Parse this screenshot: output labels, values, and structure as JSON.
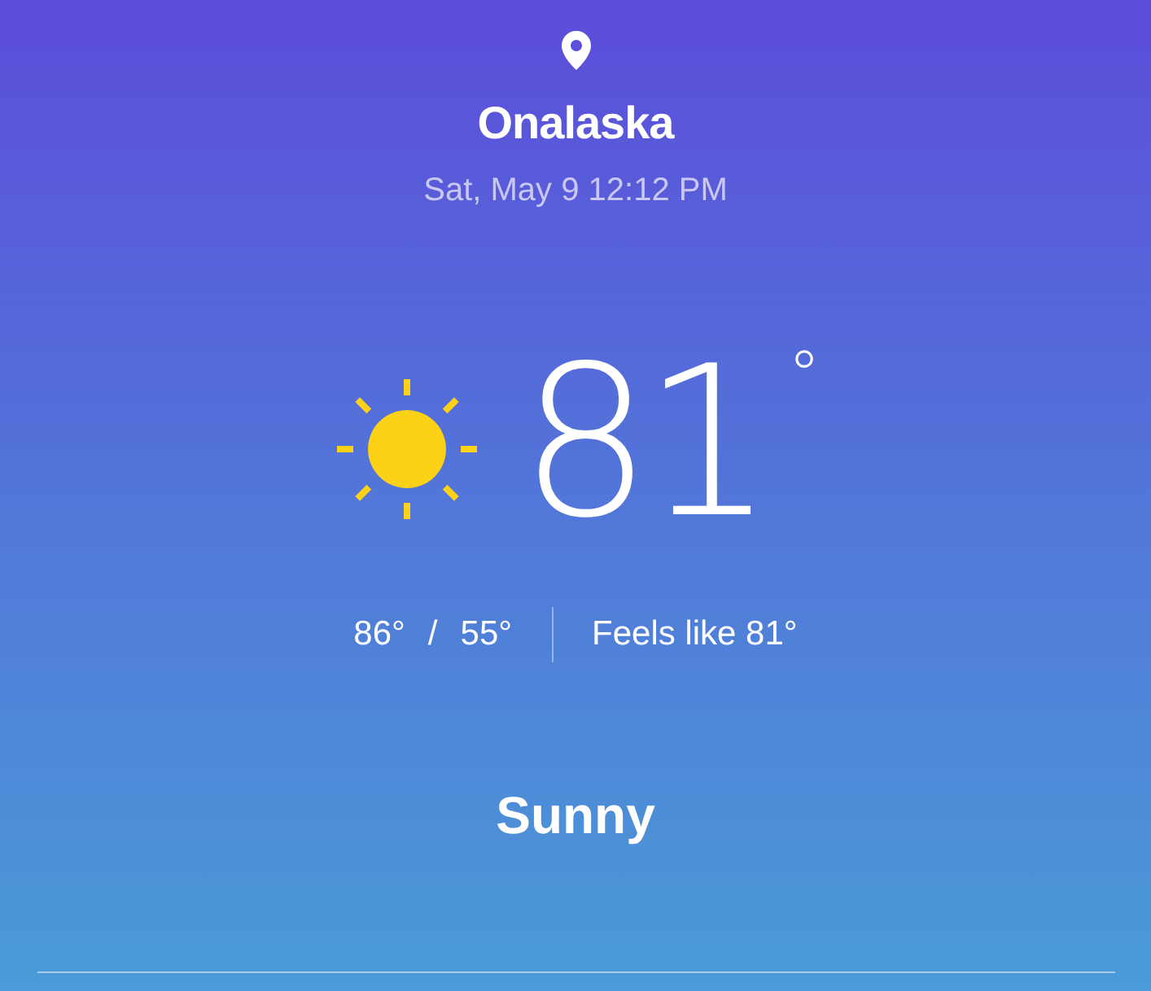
{
  "location": {
    "city": "Onalaska",
    "datetime": "Sat, May 9 12:12 PM"
  },
  "current": {
    "temperature": "81",
    "unit": "°",
    "high": "86°",
    "separator": "/",
    "low": "55°",
    "feels_like": "Feels like 81°",
    "condition": "Sunny"
  }
}
